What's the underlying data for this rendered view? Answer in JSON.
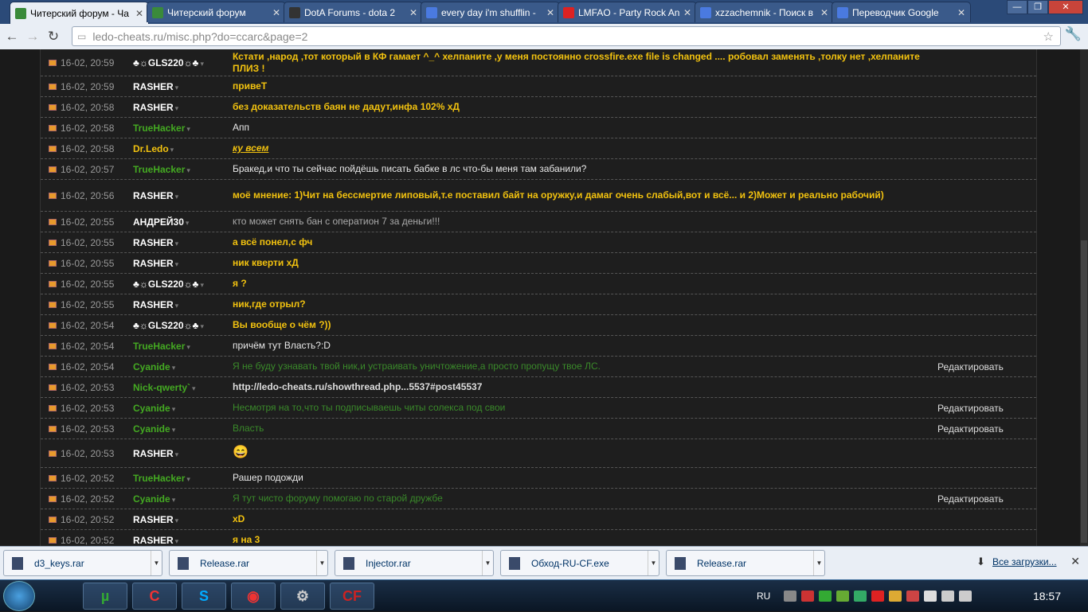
{
  "tabs": [
    {
      "title": "Читерский форум - Ча",
      "icon": "ledo-favicon",
      "active": true
    },
    {
      "title": "Читерский форум",
      "icon": "ledo-favicon",
      "active": false
    },
    {
      "title": "DotA Forums - dota 2",
      "icon": "dota-favicon",
      "active": false
    },
    {
      "title": "every day i'm shufflin -",
      "icon": "google-favicon",
      "active": false
    },
    {
      "title": "LMFAO - Party Rock An",
      "icon": "youtube-favicon",
      "active": false
    },
    {
      "title": "xzzachemnik - Поиск в",
      "icon": "google-favicon",
      "active": false
    },
    {
      "title": "Переводчик Google",
      "icon": "translate-favicon",
      "active": false
    }
  ],
  "address": {
    "host": "ledo-cheats.ru",
    "path": "/misc.php?do=ccarc&page=2"
  },
  "edit_label": "Редактировать",
  "rows": [
    {
      "time": "16-02, 20:59",
      "name": "♣☼GLS220☼♣",
      "name_color": "white",
      "msg": "Кстати ,народ ,тот который в КФ гамает ^_^ хелпаните ,у меня постоянно crossfire.exe file is changed .... робовал заменять ,толку нет ,хелпаните ПЛИЗ !",
      "style": "yellow",
      "edit": false,
      "h": 34
    },
    {
      "time": "16-02, 20:59",
      "name": "RASHER",
      "name_color": "white",
      "msg": "привеТ",
      "style": "yellow",
      "edit": false,
      "h": 26
    },
    {
      "time": "16-02, 20:58",
      "name": "RASHER",
      "name_color": "white",
      "msg": "без доказательств баян не дадут,инфа 102% хД",
      "style": "yellow",
      "edit": false,
      "h": 26
    },
    {
      "time": "16-02, 20:58",
      "name": "TrueHacker",
      "name_color": "green",
      "msg": "Апп",
      "style": "white",
      "edit": false,
      "h": 26
    },
    {
      "time": "16-02, 20:58",
      "name": "Dr.Ledo",
      "name_color": "yellow",
      "msg": "ку всем",
      "style": "italic",
      "edit": false,
      "h": 26
    },
    {
      "time": "16-02, 20:57",
      "name": "TrueHacker",
      "name_color": "green",
      "msg": "Бракед,и что ты сейчас пойдёшь писать бабке в лс что-бы меня там забанили?",
      "style": "white",
      "edit": false,
      "h": 26
    },
    {
      "time": "16-02, 20:56",
      "name": "RASHER",
      "name_color": "white",
      "msg": "моё мнение: 1)Чит на бессмертие липовый,т.е поставил байт на оружку,и дамаг очень слабый,вот и всё... и 2)Может и реально рабочий)",
      "style": "yellow",
      "edit": false,
      "h": 40
    },
    {
      "time": "16-02, 20:55",
      "name": "АНДРЕЙ30",
      "name_color": "white",
      "msg": "кто может снять бан с оператион 7 за деньги!!!",
      "style": "grey",
      "edit": false,
      "h": 26
    },
    {
      "time": "16-02, 20:55",
      "name": "RASHER",
      "name_color": "white",
      "msg": "а всё понел,с фч",
      "style": "yellow",
      "edit": false,
      "h": 26
    },
    {
      "time": "16-02, 20:55",
      "name": "RASHER",
      "name_color": "white",
      "msg": "ник кверти хД",
      "style": "yellow",
      "edit": false,
      "h": 26
    },
    {
      "time": "16-02, 20:55",
      "name": "♣☼GLS220☼♣",
      "name_color": "white",
      "msg": "я ?",
      "style": "yellow",
      "edit": false,
      "h": 26
    },
    {
      "time": "16-02, 20:55",
      "name": "RASHER",
      "name_color": "white",
      "msg": "ник,где отрыл?",
      "style": "yellow",
      "edit": false,
      "h": 26
    },
    {
      "time": "16-02, 20:54",
      "name": "♣☼GLS220☼♣",
      "name_color": "white",
      "msg": "Вы вообще о чём ?))",
      "style": "yellow",
      "edit": false,
      "h": 26
    },
    {
      "time": "16-02, 20:54",
      "name": "TrueHacker",
      "name_color": "green",
      "msg": "причём тут Власть?:D",
      "style": "white",
      "edit": false,
      "h": 26
    },
    {
      "time": "16-02, 20:54",
      "name": "Cyanide",
      "name_color": "green",
      "msg": "Я не буду узнавать твой ник,и устраивать уничтожение,а просто пропущу твое ЛС.",
      "style": "green",
      "edit": true,
      "h": 26
    },
    {
      "time": "16-02, 20:53",
      "name": "Nick-qwerty`",
      "name_color": "green",
      "msg": "http://ledo-cheats.ru/showthread.php...5537#post45537",
      "style": "link",
      "edit": false,
      "h": 26
    },
    {
      "time": "16-02, 20:53",
      "name": "Cyanide",
      "name_color": "green",
      "msg": "Несмотря на то,что ты подписываешь читы солекса под свои",
      "style": "green",
      "edit": true,
      "h": 26
    },
    {
      "time": "16-02, 20:53",
      "name": "Cyanide",
      "name_color": "green",
      "msg": "Власть",
      "style": "green",
      "edit": true,
      "h": 26
    },
    {
      "time": "16-02, 20:53",
      "name": "RASHER",
      "name_color": "white",
      "msg": "",
      "style": "smile",
      "edit": false,
      "h": 36
    },
    {
      "time": "16-02, 20:52",
      "name": "TrueHacker",
      "name_color": "green",
      "msg": "Рашер подожди",
      "style": "white",
      "edit": false,
      "h": 26
    },
    {
      "time": "16-02, 20:52",
      "name": "Cyanide",
      "name_color": "green",
      "msg": "Я тут чисто форуму помогаю по старой дружбе",
      "style": "green",
      "edit": true,
      "h": 26
    },
    {
      "time": "16-02, 20:52",
      "name": "RASHER",
      "name_color": "white",
      "msg": "xD",
      "style": "yellow",
      "edit": false,
      "h": 26
    },
    {
      "time": "16-02, 20:52",
      "name": "RASHER",
      "name_color": "white",
      "msg": "я на 3",
      "style": "yellow",
      "edit": false,
      "h": 26
    }
  ],
  "downloads": [
    "d3_keys.rar",
    "Release.rar",
    "Injector.rar",
    "Обход-RU-CF.exe",
    "Release.rar"
  ],
  "all_downloads_label": "Все загрузки...",
  "taskbar": {
    "lang": "RU",
    "clock": "18:57"
  }
}
